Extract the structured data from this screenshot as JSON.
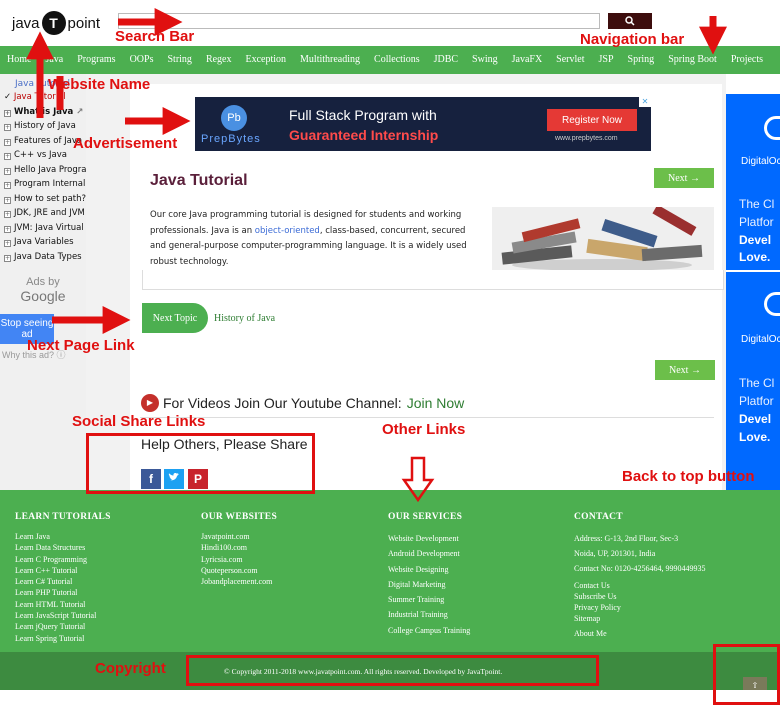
{
  "header": {
    "logo_left": "java",
    "logo_mark": "T",
    "logo_right": "point",
    "search_value": "",
    "search_icon": "magnifier-icon"
  },
  "nav": [
    "Home",
    "Java",
    "Programs",
    "OOPs",
    "String",
    "Regex",
    "Exception",
    "Multithreading",
    "Collections",
    "JDBC",
    "Swing",
    "JavaFX",
    "Servlet",
    "JSP",
    "Spring",
    "Spring Boot",
    "Projects"
  ],
  "sidebar": {
    "head": "Java Tutorial",
    "items": [
      {
        "label": "Java Tutorial",
        "active": true
      },
      {
        "label": "What is Java",
        "bold": true
      },
      {
        "label": "History of Java"
      },
      {
        "label": "Features of Java"
      },
      {
        "label": "C++ vs Java"
      },
      {
        "label": "Hello Java Program"
      },
      {
        "label": "Program Internal"
      },
      {
        "label": "How to set path?"
      },
      {
        "label": "JDK, JRE and JVM"
      },
      {
        "label": "JVM: Java Virtual Machine"
      },
      {
        "label": "Java Variables"
      },
      {
        "label": "Java Data Types"
      }
    ]
  },
  "left_ad": {
    "ads_by": "Ads by",
    "google": "Google",
    "stop_label": "Stop seeing ad",
    "why": "Why this ad?"
  },
  "ad_banner": {
    "logo": "Pb",
    "brand": "PrepBytes",
    "line1": "Full Stack Program with",
    "line2": "Guaranteed Internship",
    "button": "Register Now",
    "url": "www.prepbytes.com"
  },
  "content": {
    "title": "Java Tutorial",
    "next_label": "Next →",
    "intro_before": "Our core Java programming tutorial is designed for students and working professionals. Java is an ",
    "intro_link": "object-oriented",
    "intro_after": ", class-based, concurrent, secured and general-purpose computer-programming language. It is a widely used robust technology.",
    "next_topic_btn": "Next Topic",
    "next_topic_link": "History of Java",
    "youtube_text": "For Videos Join Our Youtube Channel:",
    "youtube_link": "Join Now",
    "share_title": "Help Others, Please Share"
  },
  "right_ad": {
    "name": "DigitalOcean",
    "line1": "The Cl",
    "line2": "Platfor",
    "line3": "Devel",
    "line4": "Love."
  },
  "footer": {
    "tutorials_title": "LEARN TUTORIALS",
    "tutorials": [
      "Learn Java",
      "Learn Data Structures",
      "Learn C Programming",
      "Learn C++ Tutorial",
      "Learn C# Tutorial",
      "Learn PHP Tutorial",
      "Learn HTML Tutorial",
      "Learn JavaScript Tutorial",
      "Learn jQuery Tutorial",
      "Learn Spring Tutorial"
    ],
    "websites_title": "OUR WEBSITES",
    "websites": [
      "Javatpoint.com",
      "Hindi100.com",
      "Lyricsia.com",
      "Quoteperson.com",
      "Jobandplacement.com"
    ],
    "services_title": "OUR SERVICES",
    "services": [
      "Website Development",
      "Android Development",
      "Website Designing",
      "Digital Marketing",
      "Summer Training",
      "Industrial Training",
      "College Campus Training"
    ],
    "contact_title": "CONTACT",
    "address1": "Address: G-13, 2nd Floor, Sec-3",
    "address2": "Noida, UP, 201301, India",
    "contact_no": "Contact No: 0120-4256464, 9990449935",
    "contact_links": [
      "Contact Us",
      "Subscribe Us",
      "Privacy Policy",
      "Sitemap"
    ],
    "about": "About Me",
    "copyright": "© Copyright 2011-2018 www.javatpoint.com. All rights reserved. Developed by JavaTpoint.",
    "back_top_icon": "arrow-up-icon"
  },
  "annotations": {
    "search_bar": "Search Bar",
    "website_name": "Website Name",
    "navigation_bar": "Navigation bar",
    "advertisement": "Advertisement",
    "next_page_link": "Next Page Link",
    "social_share": "Social Share Links",
    "other_links": "Other Links",
    "back_to_top": "Back to top button",
    "copyright": "Copyright",
    "color": "#e01010"
  }
}
